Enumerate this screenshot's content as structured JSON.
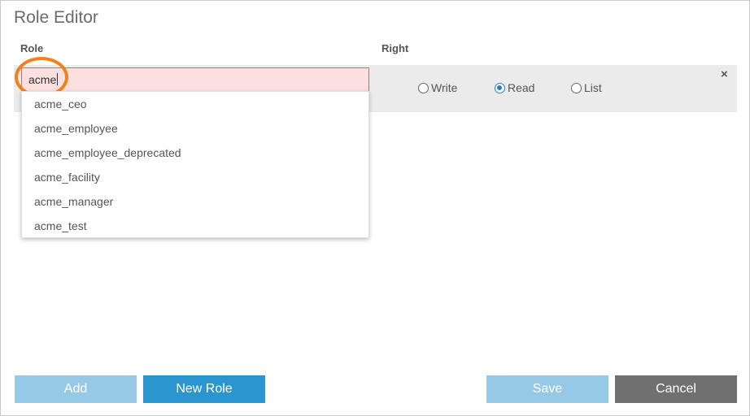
{
  "dialog": {
    "title": "Role Editor"
  },
  "columns": {
    "role": "Role",
    "right": "Right"
  },
  "role_input": {
    "value": "acme"
  },
  "suggestions": [
    "acme_ceo",
    "acme_employee",
    "acme_employee_deprecated",
    "acme_facility",
    "acme_manager",
    "acme_test"
  ],
  "rights": {
    "options": [
      {
        "label": "Write",
        "checked": false
      },
      {
        "label": "Read",
        "checked": true
      },
      {
        "label": "List",
        "checked": false
      }
    ]
  },
  "row": {
    "remove_label": "×"
  },
  "buttons": {
    "add": "Add",
    "new_role": "New Role",
    "save": "Save",
    "cancel": "Cancel"
  },
  "colors": {
    "input_error_bg": "#fbe0e0",
    "input_error_border": "#d36b6b",
    "highlight_ring": "#f0821e",
    "primary": "#2a95cf",
    "primary_disabled": "#95c9e6",
    "cancel": "#707070"
  }
}
